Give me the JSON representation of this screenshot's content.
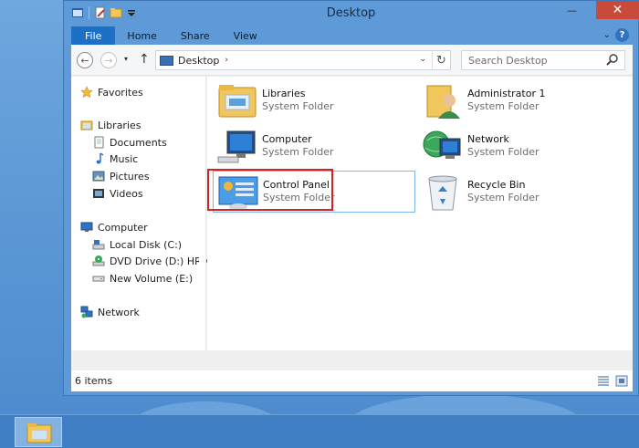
{
  "window": {
    "title": "Desktop",
    "close_glyph": "✕",
    "min_glyph": "—",
    "max_glyph": "☐"
  },
  "ribbon": {
    "tabs": [
      "File",
      "Home",
      "Share",
      "View"
    ],
    "expand_glyph": "⌄",
    "help_glyph": "?"
  },
  "address": {
    "back_glyph": "←",
    "forward_glyph": "→",
    "recent_glyph": "▾",
    "up_glyph": "↑",
    "path": "Desktop",
    "path_caret": "›",
    "dropdown_glyph": "⌄",
    "refresh_glyph": "↻",
    "search_placeholder": "Search Desktop"
  },
  "nav_pane": {
    "favorites": "Favorites",
    "libraries": "Libraries",
    "documents": "Documents",
    "music": "Music",
    "pictures": "Pictures",
    "videos": "Videos",
    "computer": "Computer",
    "local_disk": "Local Disk (C:)",
    "dvd_drive": "DVD Drive (D:) HRM",
    "new_volume": "New Volume (E:)",
    "network": "Network"
  },
  "items": [
    {
      "name": "Libraries",
      "type": "System Folder",
      "icon": "libraries-icon"
    },
    {
      "name": "Administrator 1",
      "type": "System Folder",
      "icon": "user-folder-icon"
    },
    {
      "name": "Computer",
      "type": "System Folder",
      "icon": "computer-icon"
    },
    {
      "name": "Network",
      "type": "System Folder",
      "icon": "network-icon"
    },
    {
      "name": "Control Panel",
      "type": "System Folder",
      "icon": "control-panel-icon"
    },
    {
      "name": "Recycle Bin",
      "type": "System Folder",
      "icon": "recycle-bin-icon"
    }
  ],
  "status": {
    "item_count": "6 items"
  },
  "colors": {
    "accent": "#1e6fc6",
    "highlight_border": "#d8221f",
    "selection_border": "#7eb4ea"
  }
}
